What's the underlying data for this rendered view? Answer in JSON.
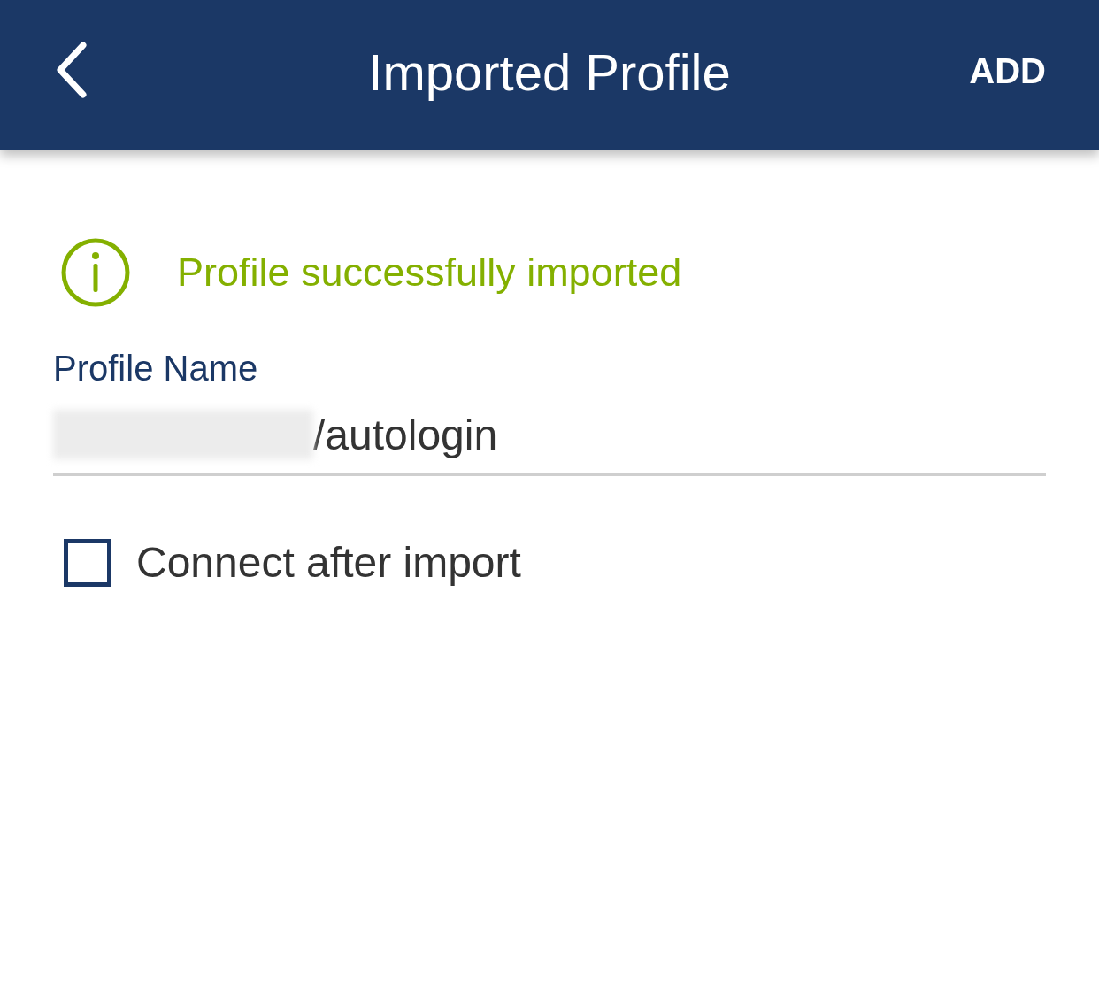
{
  "header": {
    "title": "Imported Profile",
    "action": "ADD"
  },
  "notice": {
    "text": "Profile successfully imported"
  },
  "profile_name": {
    "label": "Profile Name",
    "value": "/autologin",
    "redacted": true
  },
  "connect_checkbox": {
    "label": "Connect after import",
    "checked": false
  }
}
